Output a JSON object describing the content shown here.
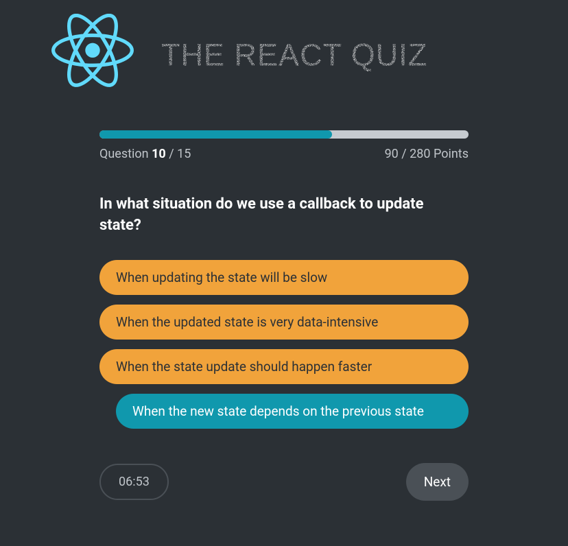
{
  "header": {
    "title": "THE REACT QUIZ",
    "logo_name": "react-logo-icon",
    "logo_color": "#61dafb"
  },
  "progress": {
    "question_label": "Question",
    "current_question": "10",
    "total_questions": "15",
    "points": "90",
    "max_points": "280",
    "points_suffix": "Points",
    "percent": 63
  },
  "question": {
    "text": "In what situation do we use a callback to update state?",
    "options": [
      {
        "label": "When updating the state will be slow",
        "state": "wrong"
      },
      {
        "label": "When the updated state is very data-intensive",
        "state": "wrong"
      },
      {
        "label": "When the state update should happen faster",
        "state": "wrong"
      },
      {
        "label": "When the new state depends on the previous state",
        "state": "correct"
      }
    ]
  },
  "footer": {
    "timer": "06:53",
    "next_label": "Next"
  }
}
